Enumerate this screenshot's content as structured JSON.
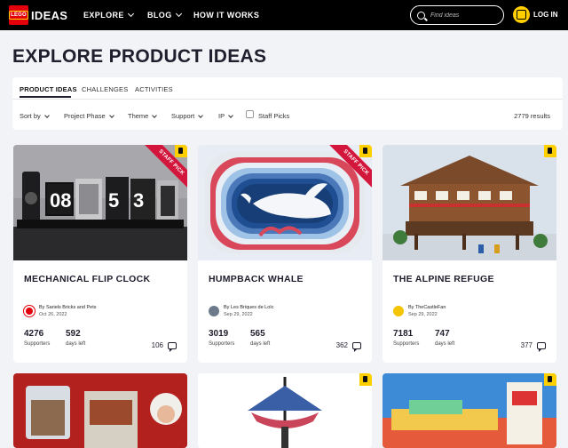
{
  "header": {
    "logo_text": "LEGO",
    "brand": "IDEAS",
    "nav": [
      {
        "label": "EXPLORE",
        "has_dropdown": true
      },
      {
        "label": "BLOG",
        "has_dropdown": true
      },
      {
        "label": "HOW IT WORKS",
        "has_dropdown": false
      }
    ],
    "search_placeholder": "Find ideas",
    "login_label": "LOG IN"
  },
  "page": {
    "title": "EXPLORE PRODUCT IDEAS",
    "tabs": [
      {
        "label": "PRODUCT IDEAS",
        "active": true
      },
      {
        "label": "CHALLENGES",
        "active": false
      },
      {
        "label": "ACTIVITIES",
        "active": false
      }
    ],
    "filters": [
      "Sort by",
      "Project Phase",
      "Theme",
      "Support",
      "IP"
    ],
    "staff_picks_label": "Staff Picks",
    "staff_picks_checked": false,
    "results": "2779 results"
  },
  "cards": [
    {
      "title": "MECHANICAL FLIP CLOCK",
      "staff_pick": true,
      "ribbon": "STAFF PICK",
      "author": "By Sariels Bricks and Pets",
      "date": "Oct 26, 2022",
      "supporters": "4276",
      "supporters_label": "Supporters",
      "days": "592",
      "days_label": "days left",
      "comments": "106"
    },
    {
      "title": "HUMPBACK WHALE",
      "staff_pick": true,
      "ribbon": "STAFF PICK",
      "author": "By Les Briques de Loïc",
      "date": "Sep 29, 2022",
      "supporters": "3019",
      "supporters_label": "Supporters",
      "days": "565",
      "days_label": "days left",
      "comments": "362"
    },
    {
      "title": "THE ALPINE REFUGE",
      "staff_pick": false,
      "author": "By TheCastleFan",
      "date": "Sep 29, 2022",
      "supporters": "7181",
      "supporters_label": "Supporters",
      "days": "747",
      "days_label": "days left",
      "comments": "377"
    }
  ],
  "colors": {
    "header_bg": "#000000",
    "accent_yellow": "#ffcf00",
    "staff_pick_red": "#d3163b",
    "page_bg": "#f2f3f7"
  }
}
